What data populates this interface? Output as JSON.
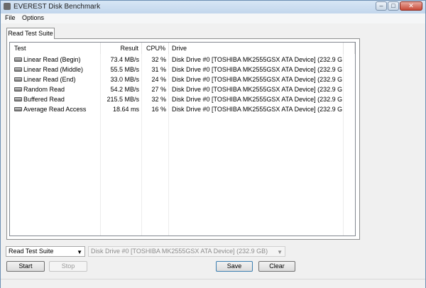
{
  "window": {
    "title": "EVEREST Disk Benchmark",
    "controls": {
      "minimize": "–",
      "maximize": "□",
      "close": "✕"
    }
  },
  "menu": {
    "file": "File",
    "options": "Options"
  },
  "tab": {
    "label": "Read Test Suite"
  },
  "table": {
    "headers": {
      "test": "Test",
      "result": "Result",
      "cpu": "CPU%",
      "drive": "Drive"
    },
    "rows": [
      {
        "test": "Linear Read (Begin)",
        "result": "73.4 MB/s",
        "cpu": "32 %",
        "drive": "Disk Drive #0  [TOSHIBA MK2555GSX ATA Device]  (232.9 G..."
      },
      {
        "test": "Linear Read (Middle)",
        "result": "55.5 MB/s",
        "cpu": "31 %",
        "drive": "Disk Drive #0  [TOSHIBA MK2555GSX ATA Device]  (232.9 G..."
      },
      {
        "test": "Linear Read (End)",
        "result": "33.0 MB/s",
        "cpu": "24 %",
        "drive": "Disk Drive #0  [TOSHIBA MK2555GSX ATA Device]  (232.9 G..."
      },
      {
        "test": "Random Read",
        "result": "54.2 MB/s",
        "cpu": "27 %",
        "drive": "Disk Drive #0  [TOSHIBA MK2555GSX ATA Device]  (232.9 G..."
      },
      {
        "test": "Buffered Read",
        "result": "215.5 MB/s",
        "cpu": "32 %",
        "drive": "Disk Drive #0  [TOSHIBA MK2555GSX ATA Device]  (232.9 G..."
      },
      {
        "test": "Average Read Access",
        "result": "18.64 ms",
        "cpu": "16 %",
        "drive": "Disk Drive #0  [TOSHIBA MK2555GSX ATA Device]  (232.9 G..."
      }
    ]
  },
  "controls": {
    "suite_select": "Read Test Suite",
    "drive_select": "Disk Drive #0  [TOSHIBA MK2555GSX ATA Device]  (232.9 GB)",
    "start": "Start",
    "stop": "Stop",
    "save": "Save",
    "clear": "Clear"
  },
  "icons": {
    "app": "disk-benchmark-icon",
    "row": "hard-disk-icon"
  }
}
